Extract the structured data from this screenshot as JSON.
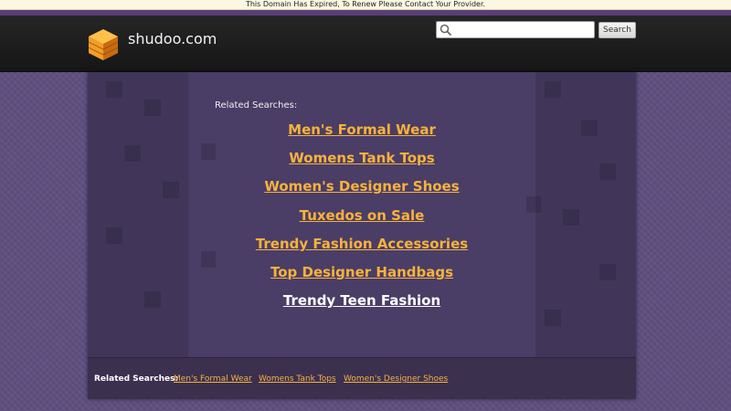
{
  "notice": "This Domain Has Expired, To Renew Please Contact Your Provider.",
  "header": {
    "site_name": "shudoo.com",
    "search_placeholder": "",
    "search_button": "Search"
  },
  "main": {
    "related_label": "Related Searches:",
    "links": [
      "Men's Formal Wear",
      "Womens Tank Tops",
      "Women's Designer Shoes",
      "Tuxedos on Sale",
      "Trendy Fashion Accessories",
      "Top Designer Handbags",
      "Trendy Teen Fashion"
    ]
  },
  "footer": {
    "related_label": "Related Searches:",
    "links": [
      "Men's Formal Wear",
      "Womens Tank Tops",
      "Women's Designer Shoes"
    ]
  },
  "colors": {
    "link": "#f8b23c",
    "link_highlight": "#ffffff",
    "header_bg": "#1c1c1c",
    "page_bg": "#5f4f7f",
    "panel_bg": "#4a3d66",
    "logo": "#f5a623"
  },
  "icons": {
    "logo": "orange-isometric-cube-icon",
    "search": "magnifier-icon"
  }
}
